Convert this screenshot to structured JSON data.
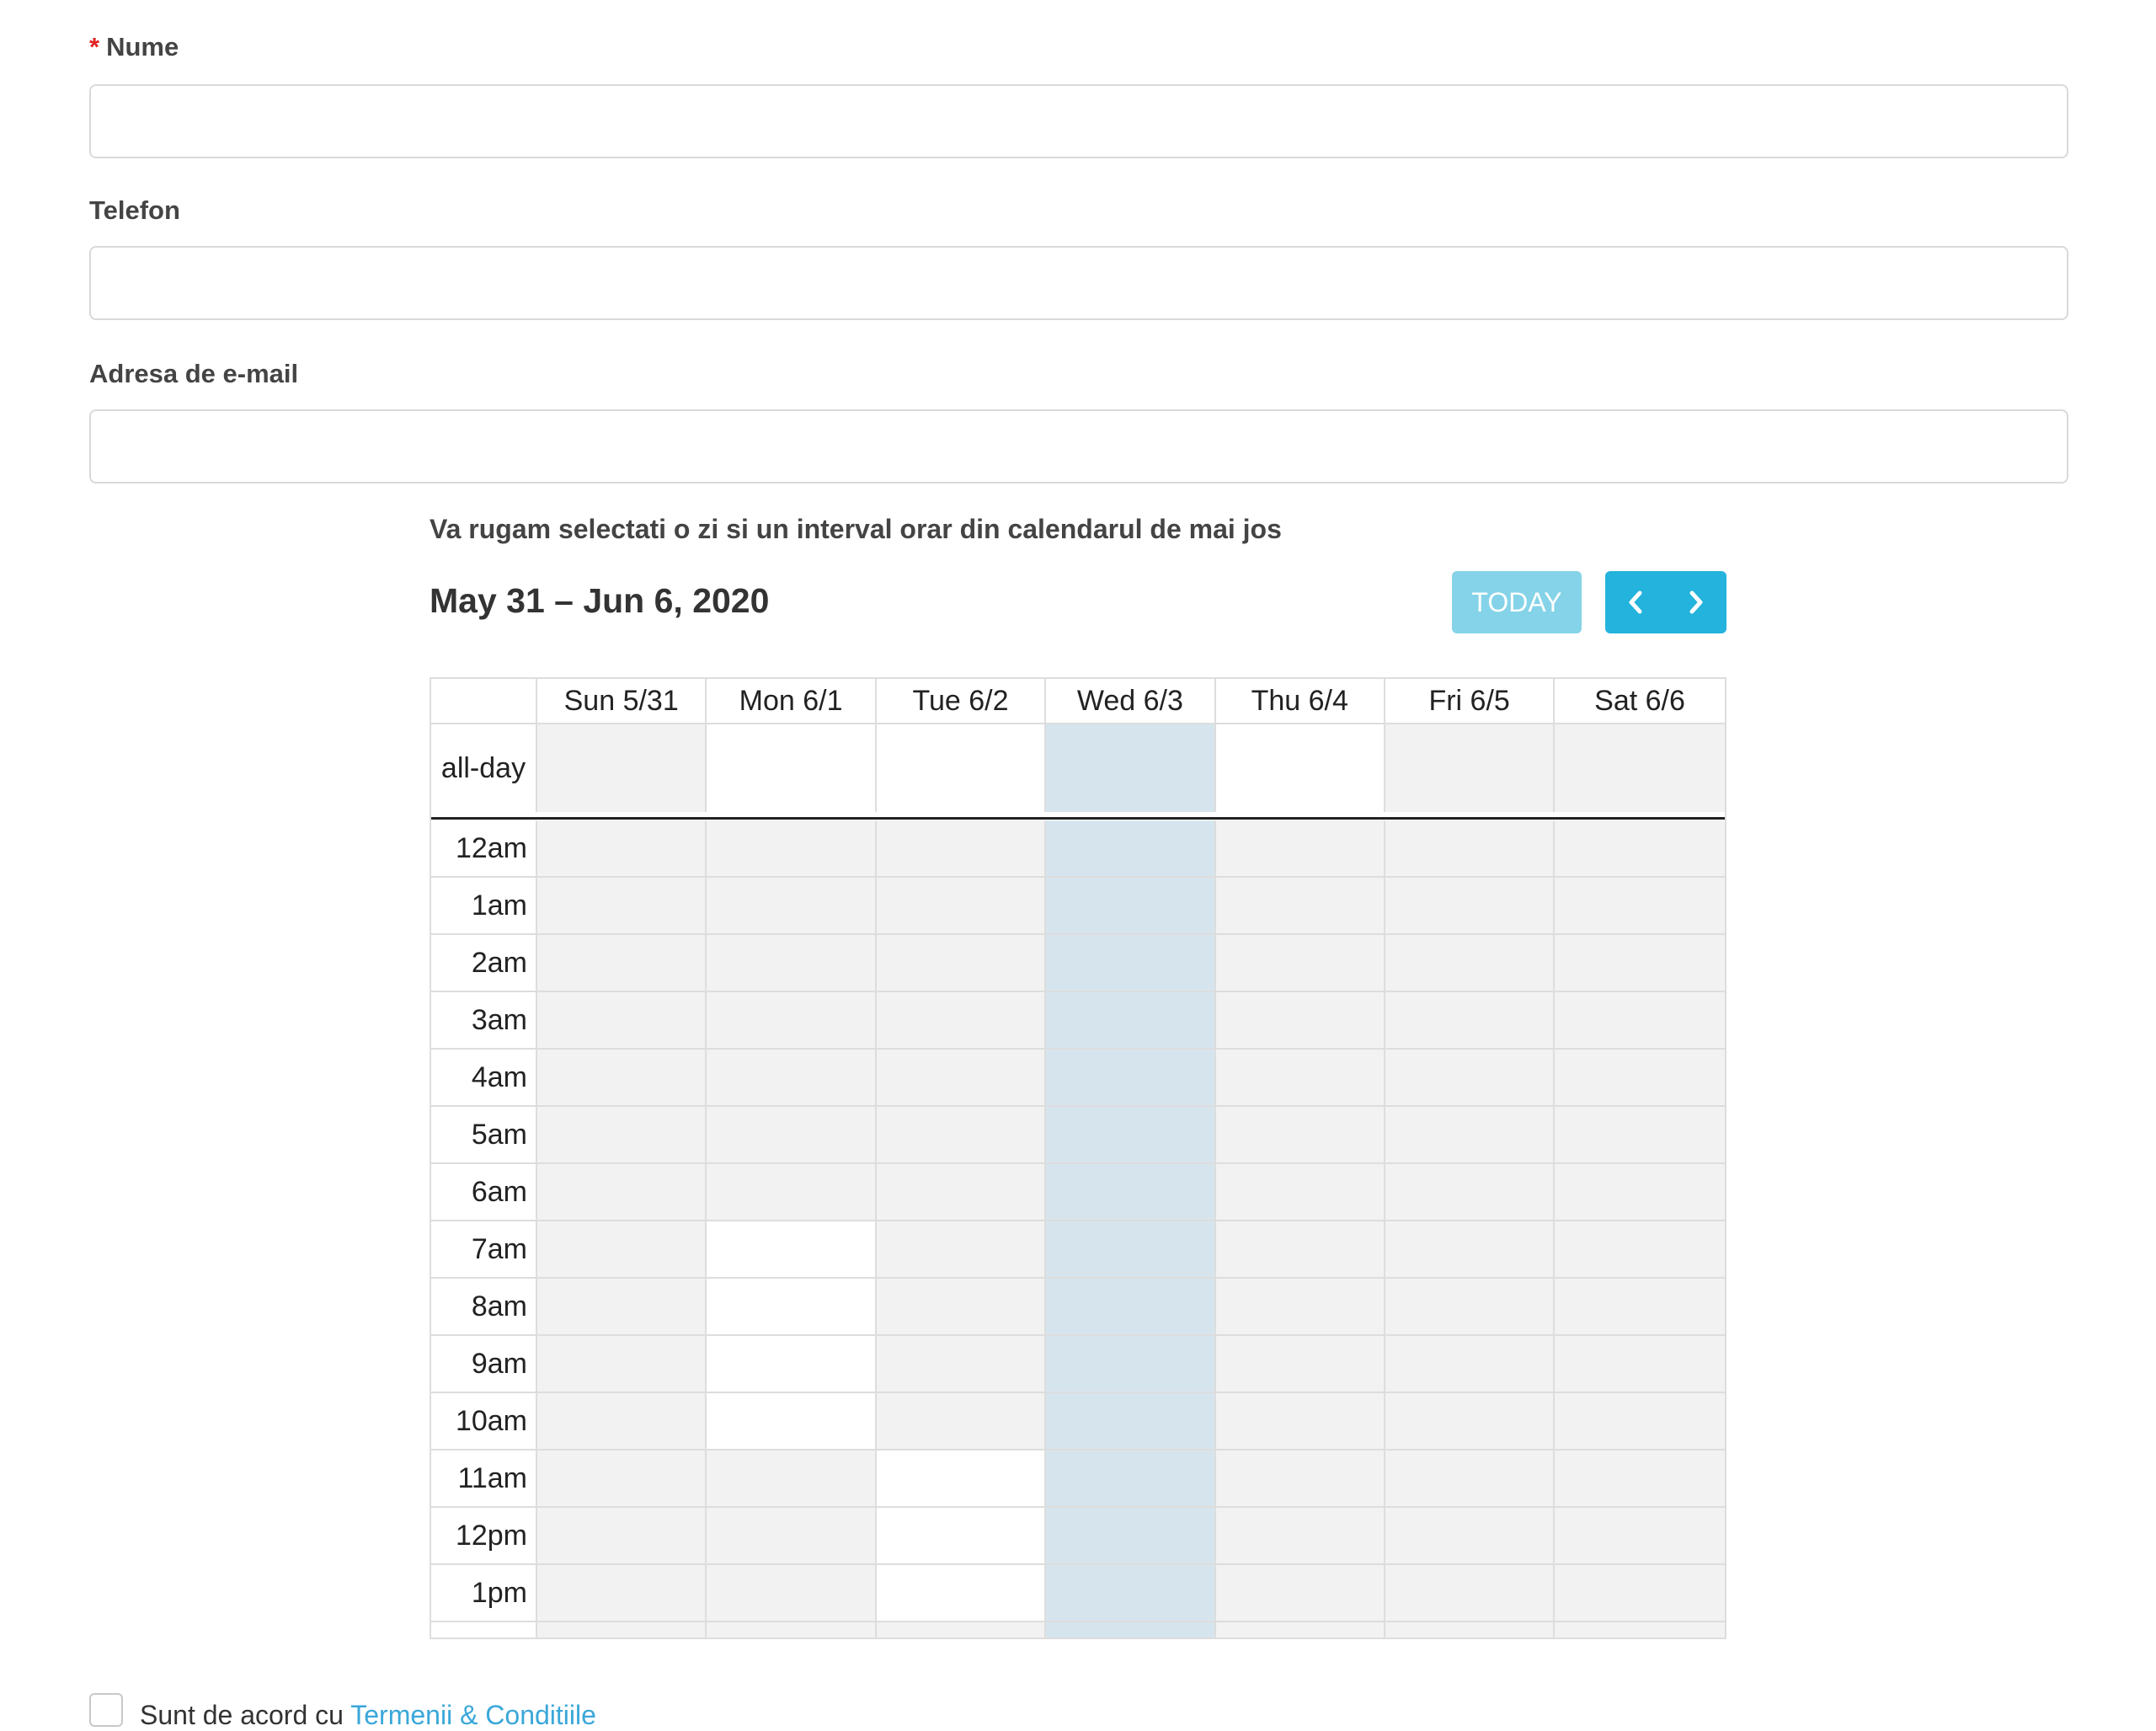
{
  "form": {
    "name_label": "Nume",
    "required_marker": "*",
    "name_value": "",
    "phone_label": "Telefon",
    "phone_value": "",
    "email_label": "Adresa de e-mail",
    "email_value": ""
  },
  "calendar": {
    "instruction": "Va rugam selectati o zi si un interval orar din calendarul de mai jos",
    "range_title": "May 31 – Jun 6, 2020",
    "today_label": "TODAY",
    "prev_icon": "chevron-left-icon",
    "next_icon": "chevron-right-icon",
    "days": [
      "Sun 5/31",
      "Mon 6/1",
      "Tue 6/2",
      "Wed 6/3",
      "Thu 6/4",
      "Fri 6/5",
      "Sat 6/6"
    ],
    "allday_label": "all-day",
    "allday_cells": [
      "gray",
      "white",
      "white",
      "today",
      "white",
      "gray",
      "gray"
    ],
    "time_slots": [
      {
        "label": "12am",
        "cells": [
          "gray",
          "gray",
          "gray",
          "today",
          "gray",
          "gray",
          "gray"
        ]
      },
      {
        "label": "1am",
        "cells": [
          "gray",
          "gray",
          "gray",
          "today",
          "gray",
          "gray",
          "gray"
        ]
      },
      {
        "label": "2am",
        "cells": [
          "gray",
          "gray",
          "gray",
          "today",
          "gray",
          "gray",
          "gray"
        ]
      },
      {
        "label": "3am",
        "cells": [
          "gray",
          "gray",
          "gray",
          "today",
          "gray",
          "gray",
          "gray"
        ]
      },
      {
        "label": "4am",
        "cells": [
          "gray",
          "gray",
          "gray",
          "today",
          "gray",
          "gray",
          "gray"
        ]
      },
      {
        "label": "5am",
        "cells": [
          "gray",
          "gray",
          "gray",
          "today",
          "gray",
          "gray",
          "gray"
        ]
      },
      {
        "label": "6am",
        "cells": [
          "gray",
          "gray",
          "gray",
          "today",
          "gray",
          "gray",
          "gray"
        ]
      },
      {
        "label": "7am",
        "cells": [
          "gray",
          "white",
          "gray",
          "today",
          "gray",
          "gray",
          "gray"
        ]
      },
      {
        "label": "8am",
        "cells": [
          "gray",
          "white",
          "gray",
          "today",
          "gray",
          "gray",
          "gray"
        ]
      },
      {
        "label": "9am",
        "cells": [
          "gray",
          "white",
          "gray",
          "today",
          "gray",
          "gray",
          "gray"
        ]
      },
      {
        "label": "10am",
        "cells": [
          "gray",
          "white",
          "gray",
          "today",
          "gray",
          "gray",
          "gray"
        ]
      },
      {
        "label": "11am",
        "cells": [
          "gray",
          "gray",
          "white",
          "today",
          "gray",
          "gray",
          "gray"
        ]
      },
      {
        "label": "12pm",
        "cells": [
          "gray",
          "gray",
          "white",
          "today",
          "gray",
          "gray",
          "gray"
        ]
      },
      {
        "label": "1pm",
        "cells": [
          "gray",
          "gray",
          "white",
          "today",
          "gray",
          "gray",
          "gray"
        ]
      },
      {
        "label": "",
        "cells": [
          "gray",
          "gray",
          "gray",
          "today",
          "gray",
          "gray",
          "gray"
        ]
      }
    ],
    "colors": {
      "gray": "#f2f2f2",
      "white": "#ffffff",
      "today": "#d6e5ed",
      "button": "#23b3dc",
      "today_button": "#84d3e8"
    }
  },
  "terms": {
    "prefix": "Sunt de acord cu ",
    "link_text": "Termenii & Conditiile",
    "checked": false
  }
}
